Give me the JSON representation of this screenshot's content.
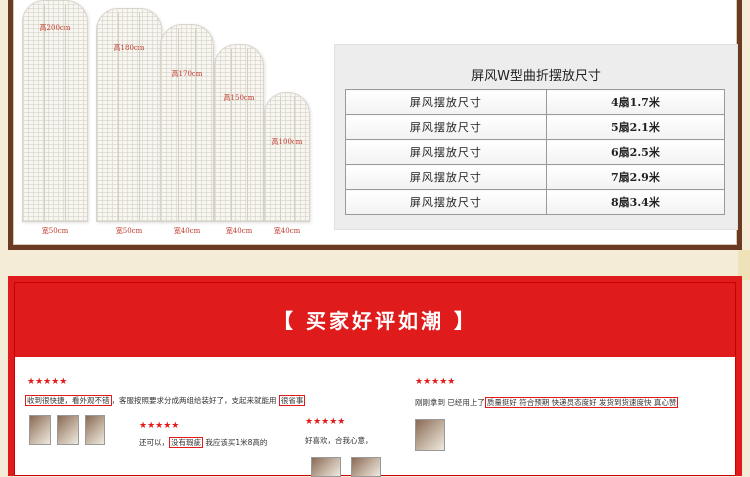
{
  "screens": [
    {
      "height": "高200cm",
      "width": "宽50cm"
    },
    {
      "height": "高180cm",
      "width": "宽50cm"
    },
    {
      "height": "高170cm",
      "width": "宽40cm"
    },
    {
      "height": "高150cm",
      "width": "宽40cm"
    },
    {
      "height": "高100cm",
      "width": "宽40cm"
    }
  ],
  "size_table": {
    "title": "屏风W型曲折摆放尺寸",
    "rows": [
      {
        "label": "屏风摆放尺寸",
        "value": "4扇1.7米"
      },
      {
        "label": "屏风摆放尺寸",
        "value": "5扇2.1米"
      },
      {
        "label": "屏风摆放尺寸",
        "value": "6扇2.5米"
      },
      {
        "label": "屏风摆放尺寸",
        "value": "7扇2.9米"
      },
      {
        "label": "屏风摆放尺寸",
        "value": "8扇3.4米"
      }
    ]
  },
  "reviews_section": {
    "title": "【 买家好评如潮 】",
    "stars": "★★★★★",
    "review1": {
      "hl1": "收到很快捷，看外观不错",
      "text": "，客服按照要求分成两组给装好了，支起来就能用",
      "hl2": "很省事"
    },
    "review2": {
      "pre": "还可以，",
      "hl": "没有瑕疵",
      "post": "我应该买1米8高的"
    },
    "review3": {
      "text": "好喜欢，合我心意，"
    },
    "review4": {
      "pre": "刚刚拿到 已经用上了",
      "hl": "质量挺好 符合预期 快递员态度好 发货到货速度快 真心赞"
    }
  }
}
